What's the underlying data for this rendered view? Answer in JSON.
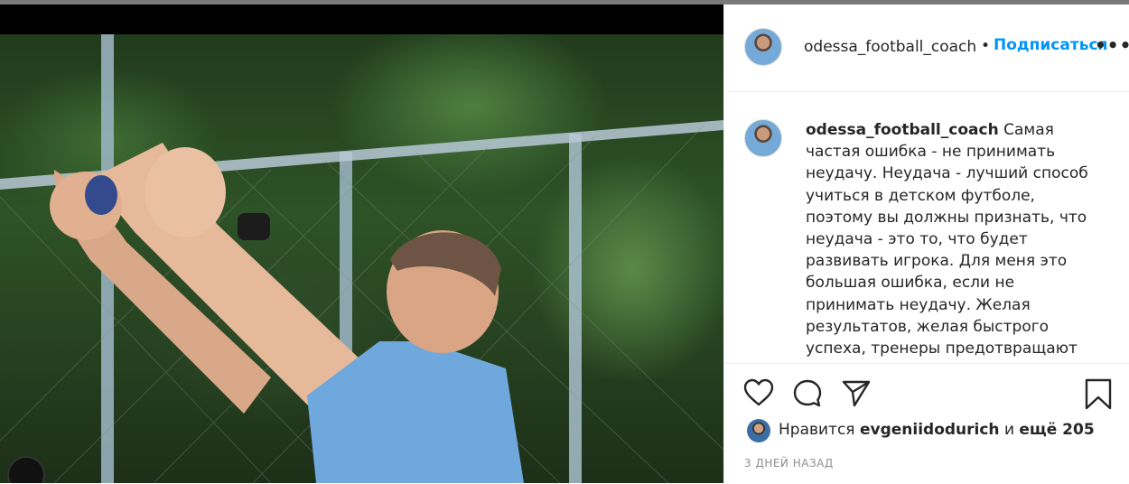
{
  "post": {
    "username": "odessa_football_coach",
    "separator": "•",
    "follow_label": "Подписаться",
    "more_label": "•••",
    "caption": "Самая частая ошибка - не принимать неудачу. Неудача - лучший способ учиться в детском футболе, поэтому вы должны признать, что неудача - это то, что будет развивать игрока. Для меня это большая ошибка, если не принимать неудачу. Желая результатов, желая быстрого успеха, тренеры предотвращают неудачу игрока. Если вы мешаете игроку",
    "likes_prefix": "Нравится",
    "liked_by": "evgeniidodurich",
    "likes_and": "и",
    "likes_others": "ещё 205",
    "timestamp": "3 ДНЕЙ НАЗАД"
  },
  "icons": {
    "like": "heart-outline-icon",
    "comment": "speech-bubble-icon",
    "share": "paper-plane-icon",
    "save": "bookmark-icon"
  },
  "colors": {
    "link": "#0095f6",
    "text": "#262626",
    "muted": "#8e8e8e"
  }
}
